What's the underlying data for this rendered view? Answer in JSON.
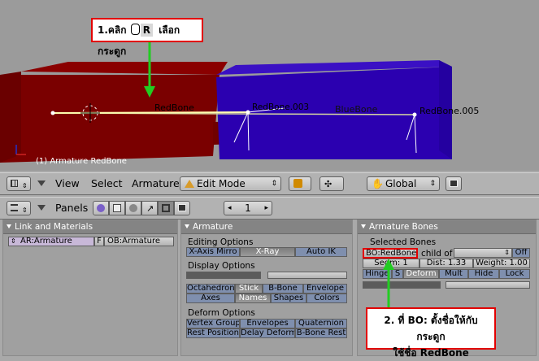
{
  "viewport": {
    "object_label": "(1) Armature RedBone",
    "bone_labels": [
      "RedBone",
      "RedBone.003",
      "BlueBone",
      "RedBone.005"
    ]
  },
  "callouts": {
    "top": {
      "prefix": "1.คลิก",
      "key": "R",
      "suffix": "เลือกกระดูก"
    },
    "bottom": {
      "line1": "2. ที่ BO: ตั้งชื่อให้กับกระดูก",
      "line2": "ใช้ชื่อ RedBone"
    }
  },
  "header3d": {
    "menus": [
      "View",
      "Select",
      "Armature"
    ],
    "mode": "Edit Mode",
    "orientation": "Global"
  },
  "buttons_header": {
    "panels_label": "Panels",
    "page_number": "1"
  },
  "link_materials": {
    "title": "Link and Materials",
    "ar_field": "AR:Armature",
    "f_label": "F",
    "ob_field": "OB:Armature"
  },
  "armature": {
    "title": "Armature",
    "editing_options": "Editing Options",
    "editing_buttons": [
      "X-Axis Mirro",
      "X-Ray",
      "Auto IK"
    ],
    "display_options": "Display Options",
    "display_row1": [
      "Octahedron",
      "Stick",
      "B-Bone",
      "Envelope"
    ],
    "display_row2": [
      "Axes",
      "Names",
      "Shapes",
      "Colors"
    ],
    "deform_options": "Deform Options",
    "deform_row1": [
      "Vertex Group",
      "Envelopes",
      "Quaternion"
    ],
    "deform_row2": [
      "Rest Position",
      "Delay Deform",
      "B-Bone Rest"
    ]
  },
  "armature_bones": {
    "title": "Armature Bones",
    "selected_bones": "Selected Bones",
    "bo_field": "BO:RedBone",
    "child_of": "child of",
    "off": "Off",
    "segm": "Segm: 1",
    "dist": "Dist: 1.33",
    "weight": "Weight: 1.00",
    "row3": [
      "Hinge",
      "S",
      "Deform",
      "Mult",
      "Hide",
      "Lock"
    ]
  },
  "colors": {
    "red_block": "#7a0000",
    "blue_block": "#2b00b0",
    "callout_border": "#e20000",
    "arrow": "#22cc22"
  }
}
